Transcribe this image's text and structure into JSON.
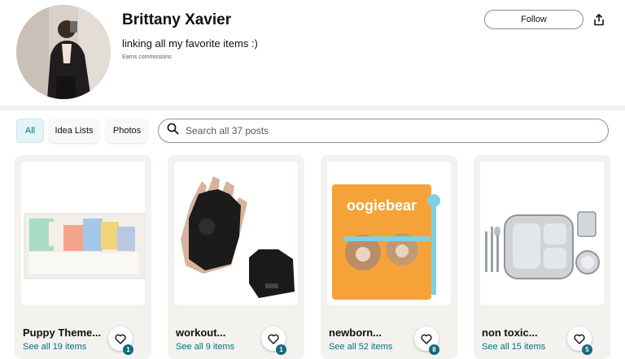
{
  "profile": {
    "name": "Brittany Xavier",
    "bio": "linking all my favorite items :)",
    "commission_note": "Earns commissions",
    "follow_label": "Follow"
  },
  "filters": {
    "tabs": [
      {
        "label": "All",
        "active": true
      },
      {
        "label": "Idea Lists",
        "active": false
      },
      {
        "label": "Photos",
        "active": false
      }
    ],
    "search_placeholder": "Search all 37 posts"
  },
  "cards": [
    {
      "title": "Puppy Theme...",
      "subtitle": "See all 19 items",
      "badge": "1",
      "image": "puppy-party-kit"
    },
    {
      "title": "workout...",
      "subtitle": "See all 9 items",
      "badge": "1",
      "image": "workout-gloves"
    },
    {
      "title": "newborn...",
      "subtitle": "See all 52 items",
      "badge": "8",
      "image": "oogiebear-package"
    },
    {
      "title": "non toxic...",
      "subtitle": "See all 15 items",
      "badge": "5",
      "image": "stainless-plates"
    }
  ],
  "product_text": {
    "oogiebear_brand": "oogiebear"
  },
  "colors": {
    "accent": "#007185",
    "badge": "#136b7a",
    "active_tab_bg": "#e3f4f7"
  }
}
